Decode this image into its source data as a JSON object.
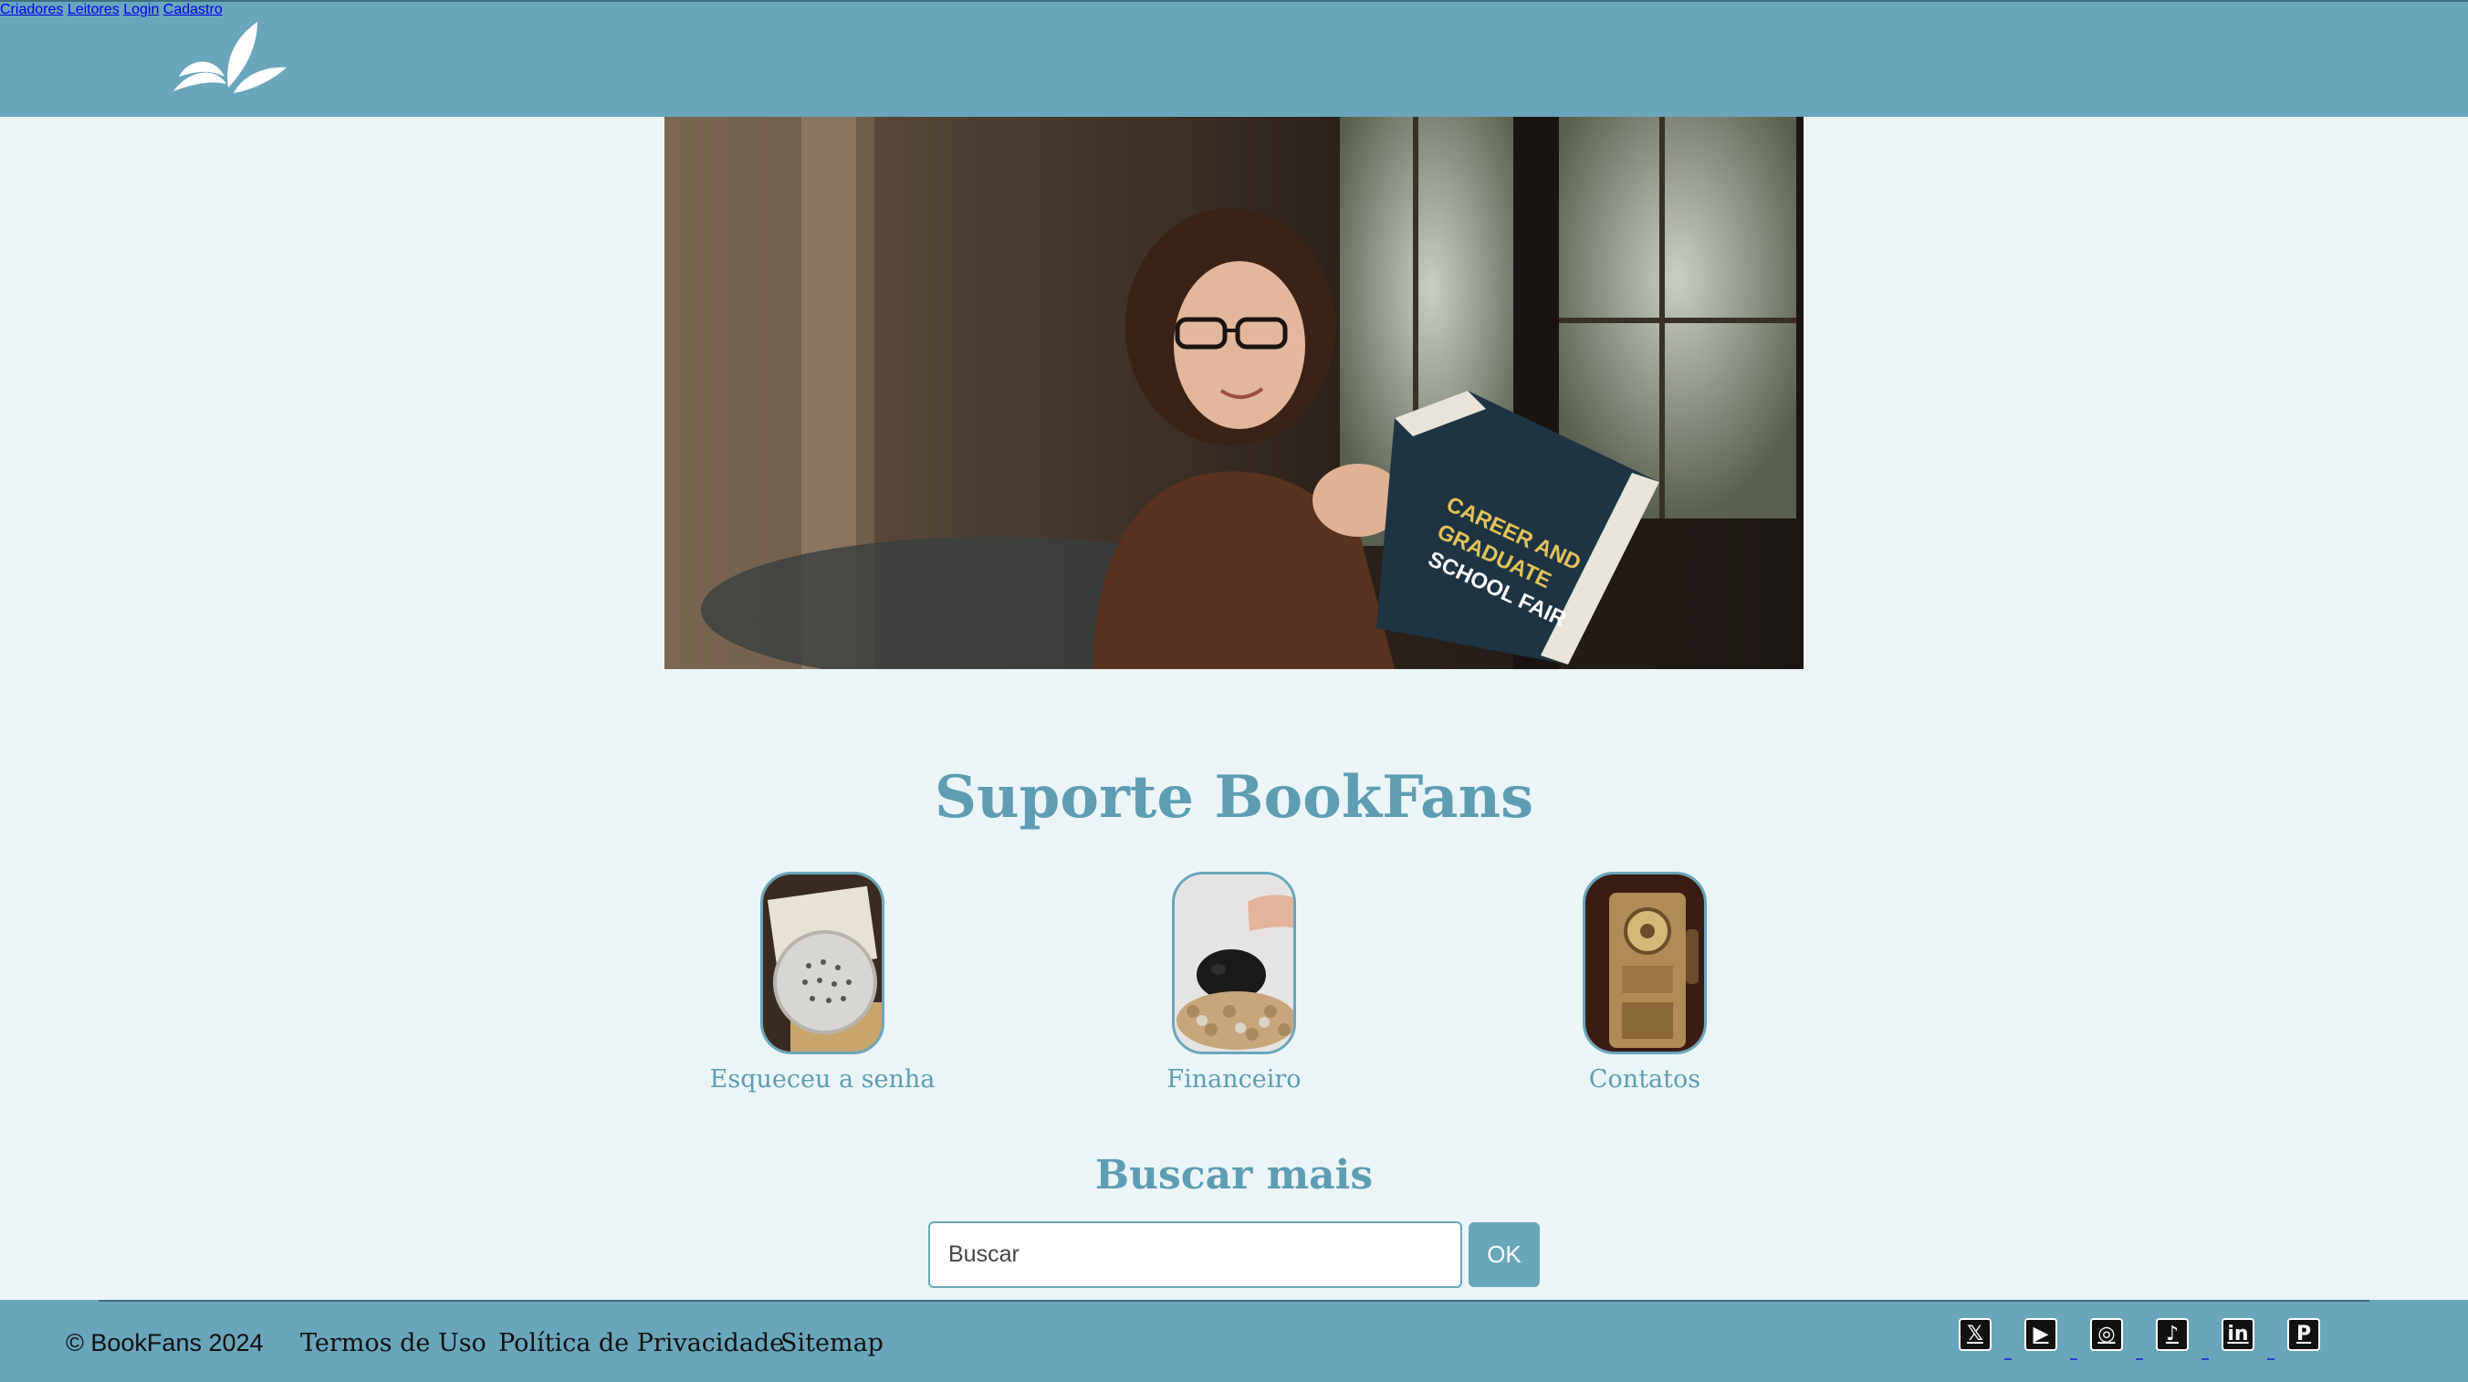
{
  "nav": {
    "creators": "Criadores",
    "readers": "Leitores",
    "login": "Login",
    "signup": "Cadastro"
  },
  "support": {
    "title": "Suporte BookFans",
    "cards": [
      {
        "label": "Esqueceu a senha"
      },
      {
        "label": "Financeiro"
      },
      {
        "label": "Contatos"
      }
    ]
  },
  "search": {
    "title": "Buscar mais",
    "placeholder": "Buscar",
    "button": "OK"
  },
  "footer": {
    "copyright": "© BookFans 2024",
    "terms": "Termos de Uso",
    "privacy": "Política de Privacidade",
    "sitemap": "Sitemap"
  },
  "social": [
    {
      "icon": "x-icon",
      "glyph": "𝕏"
    },
    {
      "icon": "youtube-icon",
      "glyph": "▶"
    },
    {
      "icon": "instagram-icon",
      "glyph": "◎"
    },
    {
      "icon": "tiktok-icon",
      "glyph": "♪"
    },
    {
      "icon": "linkedin-icon",
      "glyph": "in"
    },
    {
      "icon": "pinterest-icon",
      "glyph": "P"
    }
  ],
  "colors": {
    "brand": "#69a6bb",
    "background": "#ebf5f7",
    "heading": "#5f9db3"
  }
}
